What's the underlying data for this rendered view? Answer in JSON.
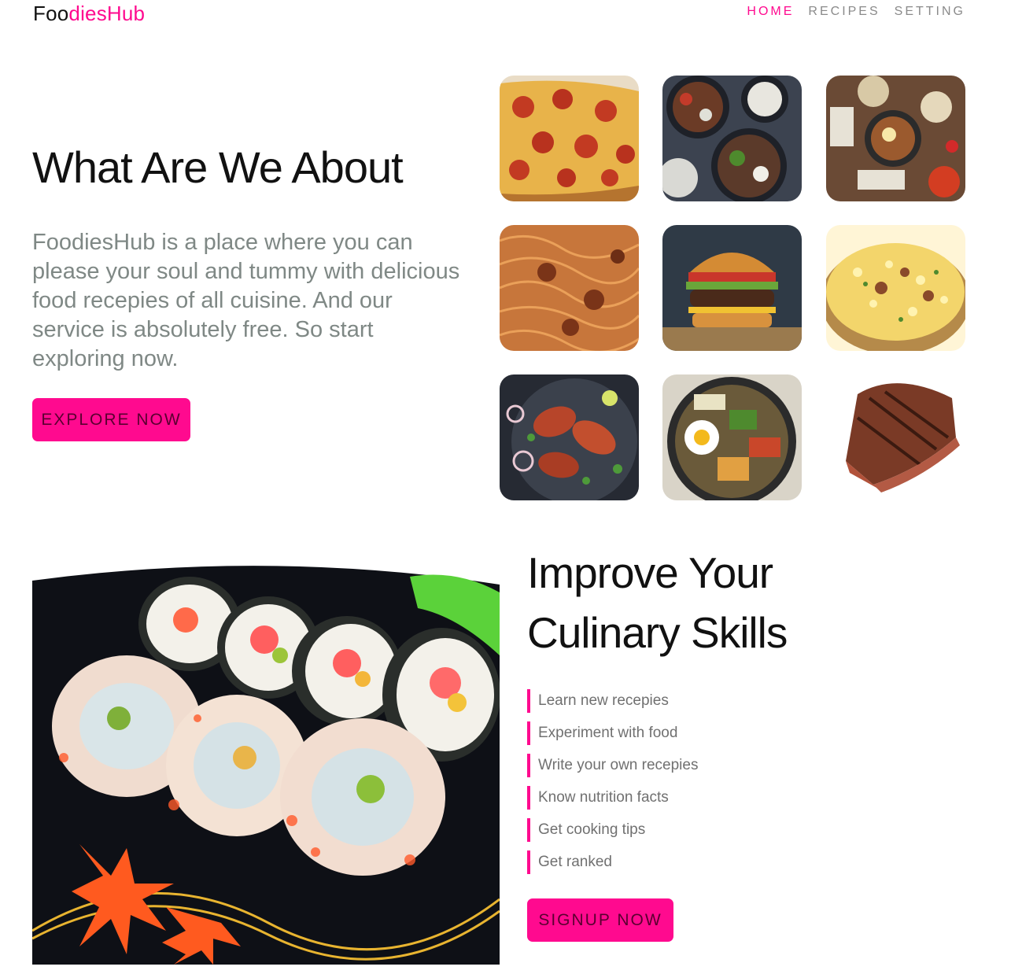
{
  "header": {
    "logo_part1": "Foo",
    "logo_part2": "diesHub",
    "nav": [
      {
        "label": "HOME",
        "active": true
      },
      {
        "label": "RECIPES",
        "active": false
      },
      {
        "label": "SETTING",
        "active": false
      }
    ]
  },
  "about": {
    "title": "What Are We About",
    "text": "FoodiesHub is a place where you can please your soul and tummy with delicious food recepies of all cuisine. And our service is absolutely free. So start exploring now.",
    "button_label": "EXPLORE NOW"
  },
  "gallery": [
    {
      "icon": "pizza-image"
    },
    {
      "icon": "rice-bowls-image"
    },
    {
      "icon": "korean-meal-image"
    },
    {
      "icon": "noodles-image"
    },
    {
      "icon": "burger-image"
    },
    {
      "icon": "biryani-image"
    },
    {
      "icon": "tandoori-chicken-image"
    },
    {
      "icon": "bibimbap-image"
    },
    {
      "icon": "grilled-steak-image"
    }
  ],
  "skills": {
    "title_line1": "Improve Your",
    "title_line2": "Culinary Skills",
    "items": [
      "Learn new recepies",
      "Experiment with food",
      "Write your own recepies",
      "Know nutrition facts",
      "Get cooking tips",
      "Get ranked"
    ],
    "button_label": "SIGNUP NOW"
  },
  "colors": {
    "accent": "#ff0a8f",
    "text_muted": "#7f8885"
  }
}
